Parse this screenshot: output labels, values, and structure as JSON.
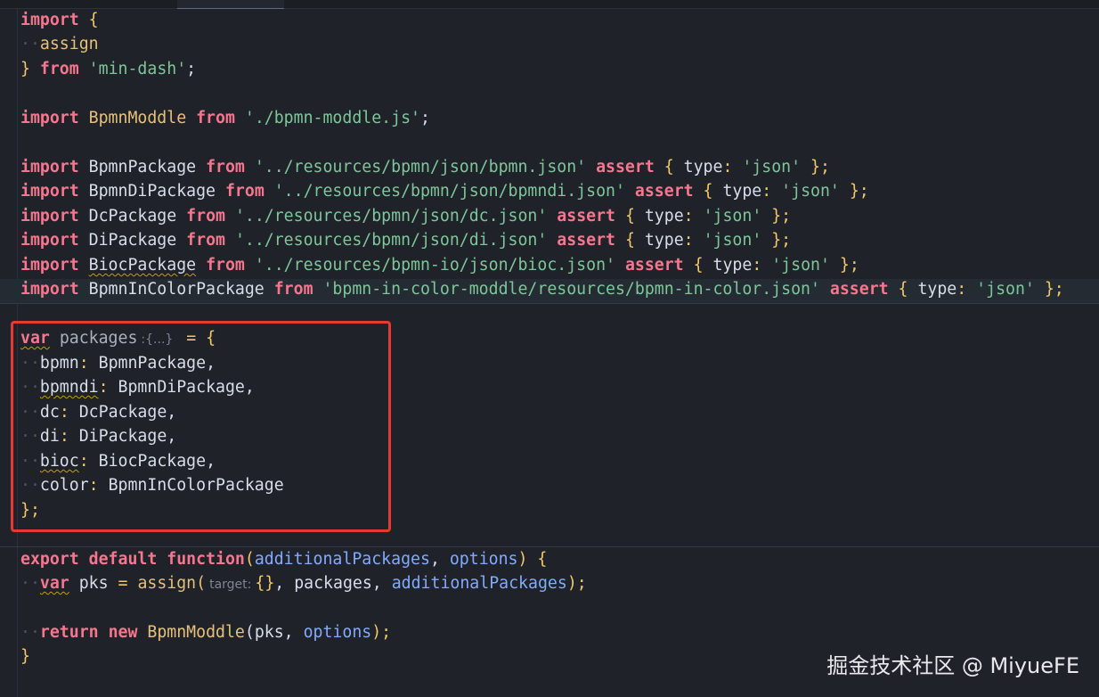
{
  "editor": {
    "lines": {
      "l1": [
        "import",
        "{"
      ],
      "l2": [
        "assign"
      ],
      "l3": [
        "}",
        "from",
        "'min-dash'",
        ";"
      ],
      "l5": [
        "import",
        "BpmnModdle",
        "from",
        "'./bpmn-moddle.js'",
        ";"
      ],
      "l7": [
        "import",
        "BpmnPackage",
        "from",
        "'../resources/bpmn/json/bpmn.json'",
        "assert",
        "{",
        "type",
        ":",
        "'json'",
        "};"
      ],
      "l8": [
        "import",
        "BpmnDiPackage",
        "from",
        "'../resources/bpmn/json/bpmndi.json'",
        "assert",
        "{",
        "type",
        ":",
        "'json'",
        "};"
      ],
      "l9": [
        "import",
        "DcPackage",
        "from",
        "'../resources/bpmn/json/dc.json'",
        "assert",
        "{",
        "type",
        ":",
        "'json'",
        "};"
      ],
      "l10": [
        "import",
        "DiPackage",
        "from",
        "'../resources/bpmn/json/di.json'",
        "assert",
        "{",
        "type",
        ":",
        "'json'",
        "};"
      ],
      "l11": [
        "import",
        "BiocPackage",
        "from",
        "'../resources/bpmn-io/json/bioc.json'",
        "assert",
        "{",
        "type",
        ":",
        "'json'",
        "};"
      ],
      "l12": [
        "import",
        "BpmnInColorPackage",
        "from",
        "'bpmn-in-color-moddle/resources/bpmn-in-color.json'",
        "assert",
        "{",
        "type",
        ":",
        "'json'",
        "};"
      ],
      "l14": [
        "var",
        "packages",
        ":{...}",
        "=",
        "{"
      ],
      "l15": [
        "bpmn",
        ":",
        "BpmnPackage,"
      ],
      "l16": [
        "bpmndi",
        ":",
        "BpmnDiPackage,"
      ],
      "l17": [
        "dc",
        ":",
        "DcPackage,"
      ],
      "l18": [
        "di",
        ":",
        "DiPackage,"
      ],
      "l19": [
        "bioc",
        ":",
        "BiocPackage,"
      ],
      "l20": [
        "color",
        ":",
        "BpmnInColorPackage"
      ],
      "l21": [
        "};"
      ],
      "l23": [
        "export",
        "default",
        "function",
        "(",
        "additionalPackages",
        ",",
        "options",
        ")",
        "{"
      ],
      "l24": [
        "var",
        "pks",
        "=",
        "assign(",
        "target:",
        "{}",
        ", packages, ",
        "additionalPackages",
        ");"
      ],
      "l26": [
        "return",
        "new",
        "BpmnModdle",
        "(pks, ",
        "options",
        ");"
      ],
      "l27": [
        "}"
      ]
    }
  },
  "watermark": "掘金技术社区 @ MiyueFE",
  "colors": {
    "background": "#1f2329",
    "keyword": "#f7768e",
    "string": "#7ec699",
    "class": "#e6c07b",
    "highlight_box": "#e53935"
  }
}
